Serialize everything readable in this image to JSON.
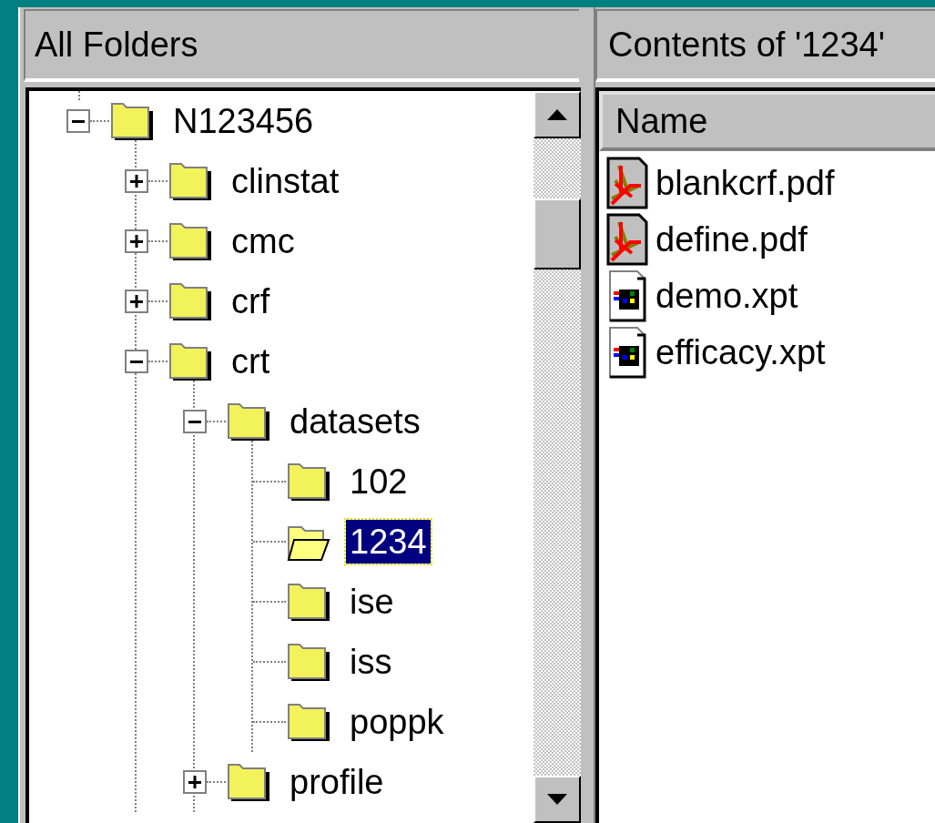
{
  "left_pane": {
    "title": "All Folders",
    "tree": [
      {
        "label": "N123456",
        "expanded": true,
        "selected": false,
        "children": [
          {
            "label": "clinstat",
            "expanded": false,
            "selected": false
          },
          {
            "label": "cmc",
            "expanded": false,
            "selected": false
          },
          {
            "label": "crf",
            "expanded": false,
            "selected": false
          },
          {
            "label": "crt",
            "expanded": true,
            "selected": false,
            "children": [
              {
                "label": "datasets",
                "expanded": true,
                "selected": false,
                "children": [
                  {
                    "label": "102",
                    "selected": false
                  },
                  {
                    "label": "1234",
                    "selected": true
                  },
                  {
                    "label": "ise",
                    "selected": false
                  },
                  {
                    "label": "iss",
                    "selected": false
                  },
                  {
                    "label": "poppk",
                    "selected": false
                  }
                ]
              },
              {
                "label": "profile",
                "expanded": false,
                "selected": false
              }
            ]
          }
        ]
      }
    ]
  },
  "right_pane": {
    "title": "Contents of '1234'",
    "columns": [
      "Name"
    ],
    "files": [
      {
        "name": "blankcrf.pdf",
        "kind": "pdf"
      },
      {
        "name": "define.pdf",
        "kind": "pdf"
      },
      {
        "name": "demo.xpt",
        "kind": "xpt"
      },
      {
        "name": "efficacy.xpt",
        "kind": "xpt"
      }
    ]
  }
}
